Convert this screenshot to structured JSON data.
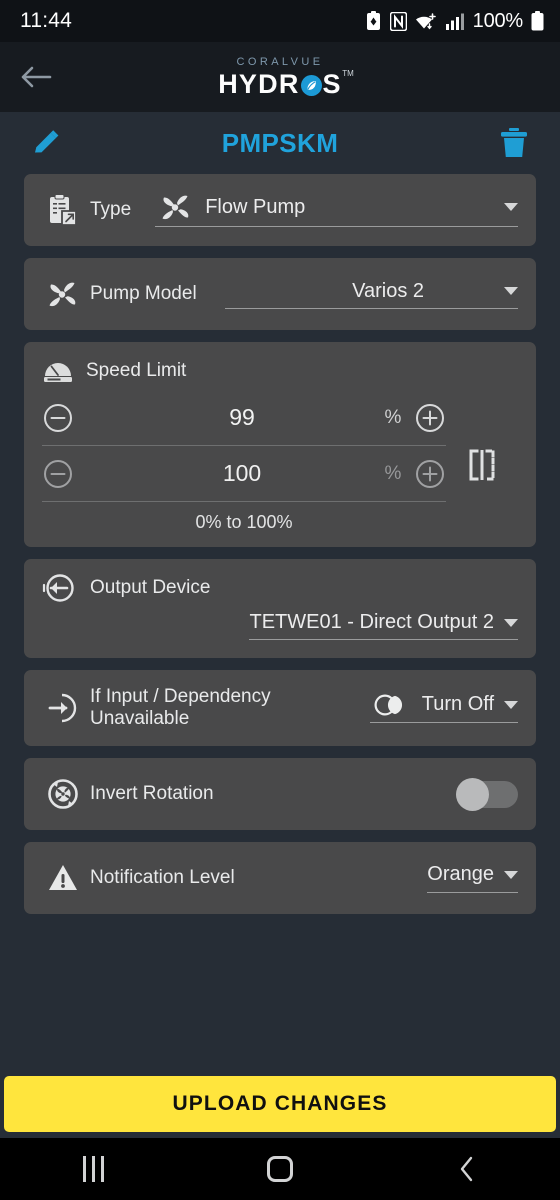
{
  "status_bar": {
    "time": "11:44",
    "battery_percent": "100%",
    "icons": [
      "battery-saver-icon",
      "nfc-icon",
      "wifi-icon",
      "cellular-signal-icon",
      "battery-icon"
    ]
  },
  "app_bar": {
    "back_icon": "back-arrow-icon",
    "brand_top": "CORALVUE",
    "brand_left": "HYDR",
    "brand_right": "S",
    "brand_tm": "TM"
  },
  "title_bar": {
    "edit_icon": "pencil-icon",
    "device_name": "PMPSKM",
    "delete_icon": "trash-icon",
    "accent_color": "#20a3dc"
  },
  "type_card": {
    "icon": "clipboard-icon",
    "label": "Type",
    "value_icon": "fan-icon",
    "value": "Flow Pump"
  },
  "pump_model_card": {
    "icon": "fan-icon",
    "label": "Pump Model",
    "value": "Varios 2"
  },
  "speed_limit_card": {
    "icon": "gauge-icon",
    "label": "Speed Limit",
    "rows": [
      {
        "minus_icon": "minus-circle-icon",
        "value": "99",
        "unit": "%",
        "plus_icon": "plus-circle-icon"
      },
      {
        "minus_icon": "minus-circle-icon",
        "value": "100",
        "unit": "%",
        "plus_icon": "plus-circle-icon"
      }
    ],
    "range_hint": "0% to 100%",
    "mirror_icon": "mirror-flip-icon"
  },
  "output_device_card": {
    "icon": "output-arrow-icon",
    "label": "Output Device",
    "value": "TETWE01 - Direct Output 2"
  },
  "dependency_card": {
    "icon": "input-arrow-icon",
    "label": "If Input / Dependency Unavailable",
    "value_icon": "toggle-circles-icon",
    "value": "Turn Off"
  },
  "invert_rotation_card": {
    "icon": "invert-rotation-icon",
    "label": "Invert Rotation",
    "toggle_state": "off"
  },
  "notification_card": {
    "icon": "warning-triangle-icon",
    "label": "Notification Level",
    "value": "Orange"
  },
  "upload_button": {
    "label": "UPLOAD CHANGES",
    "color": "#ffe53d"
  },
  "nav_bar": {
    "recents_icon": "recents-icon",
    "home_icon": "home-icon",
    "back_icon": "back-icon"
  }
}
